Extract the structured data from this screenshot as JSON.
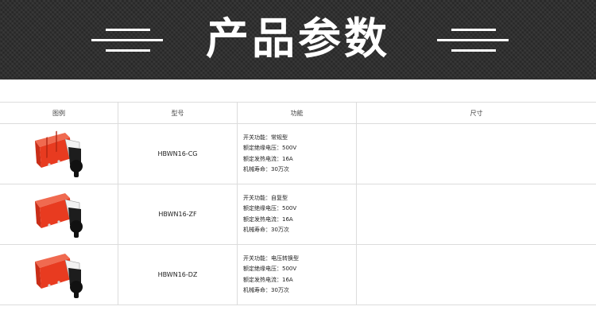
{
  "banner": {
    "title": "产品参数"
  },
  "table": {
    "headers": [
      "图例",
      "型号",
      "功能",
      "尺寸"
    ],
    "rows": [
      {
        "model": "HBWN16-CG",
        "specs": [
          "开关功能：常规型",
          "额定绝缘电压：500V",
          "额定发热电流：16A",
          "机械寿命：30万次"
        ]
      },
      {
        "model": "HBWN16-ZF",
        "specs": [
          "开关功能：自复型",
          "额定绝缘电压：500V",
          "额定发热电流：16A",
          "机械寿命：30万次"
        ]
      },
      {
        "model": "HBWN16-DZ",
        "specs": [
          "开关功能：电压转换型",
          "额定绝缘电压：500V",
          "额定发热电流：16A",
          "机械寿命：30万次"
        ]
      }
    ]
  },
  "colors": {
    "banner_bg": "#2b2b2b",
    "switch_red": "#e83b20",
    "switch_knob": "#111111",
    "grid": "#dcdcdc"
  },
  "icons": {
    "product_image": "rotary-switch-icon"
  }
}
